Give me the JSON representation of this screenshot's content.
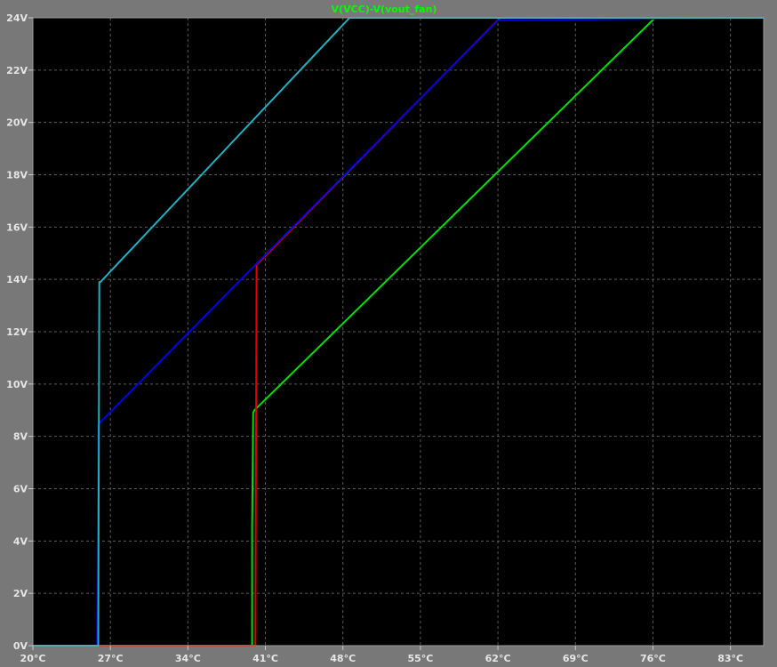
{
  "chart_data": {
    "type": "line",
    "title": "V(VCC)-V(vout_fan)",
    "title_color": "#00ff00",
    "background": "#000000",
    "grid": true,
    "grid_color": "#5a5a5a",
    "xlabel": "",
    "ylabel": "",
    "xlim": [
      20,
      86
    ],
    "ylim": [
      0,
      24
    ],
    "x_unit": "°C",
    "y_unit": "V",
    "x_ticks": [
      20,
      27,
      34,
      41,
      48,
      55,
      62,
      69,
      76,
      83
    ],
    "x_tick_labels": [
      "20°C",
      "27°C",
      "34°C",
      "41°C",
      "48°C",
      "55°C",
      "62°C",
      "69°C",
      "76°C",
      "83°C"
    ],
    "y_ticks": [
      0,
      2,
      4,
      6,
      8,
      10,
      12,
      14,
      16,
      18,
      20,
      22,
      24
    ],
    "y_tick_labels": [
      "0V",
      "2V",
      "4V",
      "6V",
      "8V",
      "10V",
      "12V",
      "14V",
      "16V",
      "18V",
      "20V",
      "22V",
      "24V"
    ],
    "series": [
      {
        "color": "#00e000",
        "x": [
          20,
          39.8,
          39.8,
          39.9,
          40.0,
          76.2,
          86
        ],
        "y": [
          0,
          0,
          4.5,
          8.9,
          9.0,
          24,
          24
        ]
      },
      {
        "color": "#e00000",
        "x": [
          20,
          40.1,
          40.2,
          40.3,
          62.2,
          86
        ],
        "y": [
          0,
          0,
          14.6,
          14.6,
          24,
          24
        ]
      },
      {
        "color": "#0000e0",
        "x": [
          20,
          25.8,
          25.9,
          26.0,
          40.2,
          62.0,
          86
        ],
        "y": [
          0,
          0,
          8.4,
          8.5,
          14.6,
          23.9,
          24
        ]
      },
      {
        "color": "#20b0c0",
        "x": [
          20,
          25.9,
          26.0,
          26.1,
          48.6,
          86
        ],
        "y": [
          0,
          0,
          13.9,
          13.9,
          24,
          24
        ]
      }
    ]
  }
}
